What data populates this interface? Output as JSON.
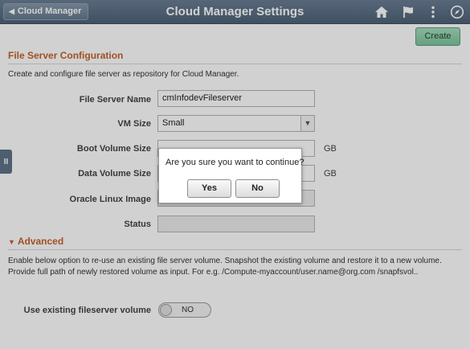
{
  "header": {
    "back_label": "Cloud Manager",
    "title": "Cloud Manager Settings",
    "icons": [
      "home-icon",
      "flag-icon",
      "more-vertical-icon",
      "navbar-compass-icon"
    ]
  },
  "toolbar": {
    "create_label": "Create"
  },
  "file_server": {
    "section_title": "File Server Configuration",
    "description": "Create and configure file server as repository for Cloud Manager.",
    "fields": {
      "name": {
        "label": "File Server Name",
        "value": "cmInfodevFileserver"
      },
      "vm_size": {
        "label": "VM Size",
        "value": "Small"
      },
      "boot_volume": {
        "label": "Boot Volume Size",
        "value": "",
        "unit": "GB"
      },
      "data_volume": {
        "label": "Data Volume Size",
        "value": "",
        "unit": "GB"
      },
      "oracle_linux": {
        "label": "Oracle Linux Image",
        "value": ""
      },
      "status": {
        "label": "Status",
        "value": ""
      }
    }
  },
  "advanced": {
    "title": "Advanced",
    "description": "Enable below option to re-use an existing file server volume. Snapshot the existing volume and restore it to a new volume. Provide full path of newly restored volume as input. For e.g. /Compute-myaccount/user.name@org.com /snapfsvol..",
    "toggle_label": "Use existing fileserver volume",
    "toggle_value": "NO"
  },
  "dialog": {
    "message": "Are you sure you want to continue?",
    "yes_label": "Yes",
    "no_label": "No"
  },
  "colors": {
    "header": "#5b6f84",
    "accent": "#c5622b",
    "create_button": "#8fcfaa"
  }
}
